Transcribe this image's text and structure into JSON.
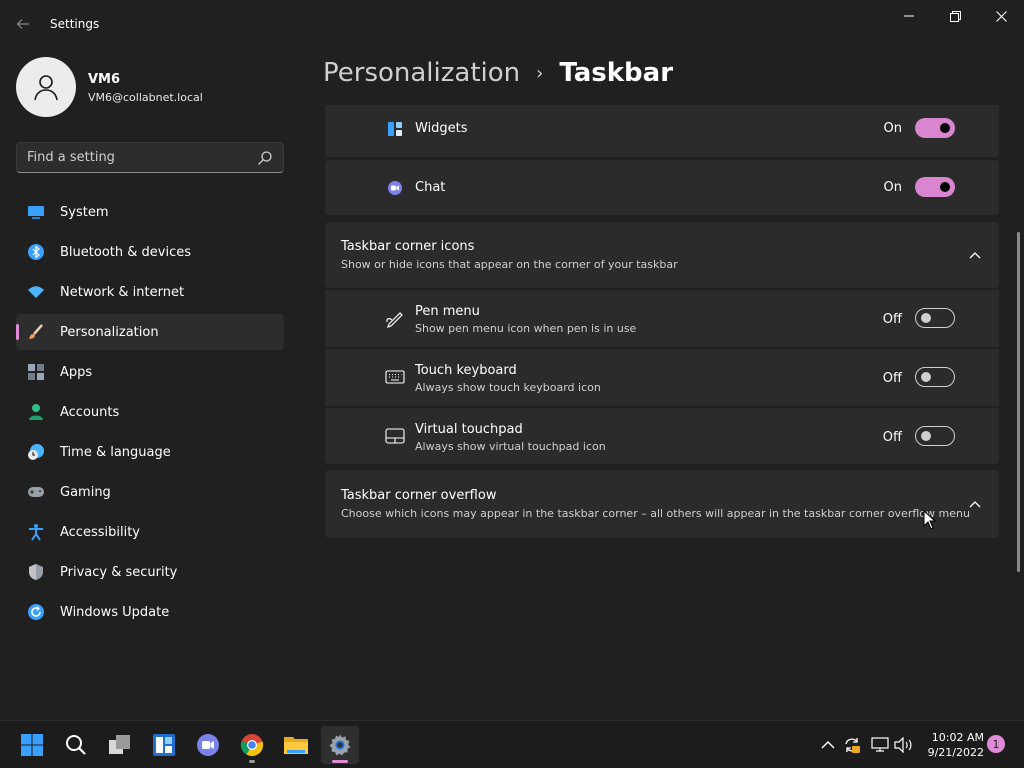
{
  "app": {
    "title": "Settings",
    "back_icon": "arrow-left-icon"
  },
  "window_controls": [
    "minimize-icon",
    "restore-icon",
    "close-icon"
  ],
  "profile": {
    "name": "VM6",
    "email": "VM6@collabnet.local"
  },
  "search": {
    "placeholder": "Find a setting",
    "icon": "search-icon"
  },
  "nav": [
    {
      "label": "System",
      "icon": "monitor-icon",
      "color": "#3aa0ff"
    },
    {
      "label": "Bluetooth & devices",
      "icon": "bluetooth-icon",
      "color": "#3aa0ff"
    },
    {
      "label": "Network & internet",
      "icon": "wifi-icon",
      "color": "#4cb3ff"
    },
    {
      "label": "Personalization",
      "icon": "brush-icon",
      "color": "#f0a060",
      "active": true
    },
    {
      "label": "Apps",
      "icon": "apps-icon",
      "color": "#9aa7b8"
    },
    {
      "label": "Accounts",
      "icon": "person-icon",
      "color": "#2fc08a"
    },
    {
      "label": "Time & language",
      "icon": "clock-globe-icon",
      "color": "#4cb3ff"
    },
    {
      "label": "Gaming",
      "icon": "gamepad-icon",
      "color": "#9aa0a8"
    },
    {
      "label": "Accessibility",
      "icon": "accessibility-icon",
      "color": "#3aa0ff"
    },
    {
      "label": "Privacy & security",
      "icon": "shield-icon",
      "color": "#9aa0a8"
    },
    {
      "label": "Windows Update",
      "icon": "refresh-icon",
      "color": "#3aa0ff"
    }
  ],
  "breadcrumb": {
    "parent": "Personalization",
    "separator": "›",
    "current": "Taskbar"
  },
  "taskbar_items": [
    {
      "label": "Widgets",
      "state": "On",
      "on": true,
      "icon": "widgets-icon"
    },
    {
      "label": "Chat",
      "state": "On",
      "on": true,
      "icon": "chat-icon"
    }
  ],
  "corner_icons": {
    "title": "Taskbar corner icons",
    "description": "Show or hide icons that appear on the corner of your taskbar",
    "items": [
      {
        "label": "Pen menu",
        "description": "Show pen menu icon when pen is in use",
        "state": "Off",
        "on": false,
        "icon": "pen-icon"
      },
      {
        "label": "Touch keyboard",
        "description": "Always show touch keyboard icon",
        "state": "Off",
        "on": false,
        "icon": "keyboard-icon"
      },
      {
        "label": "Virtual touchpad",
        "description": "Always show virtual touchpad icon",
        "state": "Off",
        "on": false,
        "icon": "touchpad-icon"
      }
    ]
  },
  "corner_overflow": {
    "title": "Taskbar corner overflow",
    "description": "Choose which icons may appear in the taskbar corner – all others will appear in the taskbar corner overflow menu"
  },
  "taskbar": {
    "apps": [
      "start-icon",
      "search-icon",
      "task-view-icon",
      "widgets-icon",
      "chat-icon",
      "chrome-icon",
      "file-explorer-icon",
      "settings-gear-icon"
    ],
    "tray": [
      "chevron-up-icon",
      "sync-icon",
      "network-icon",
      "volume-icon"
    ],
    "time": "10:02 AM",
    "date": "9/21/2022",
    "notifications": "1"
  },
  "colors": {
    "accent": "#d985d0",
    "background": "#202020",
    "card": "#2b2b2b"
  }
}
